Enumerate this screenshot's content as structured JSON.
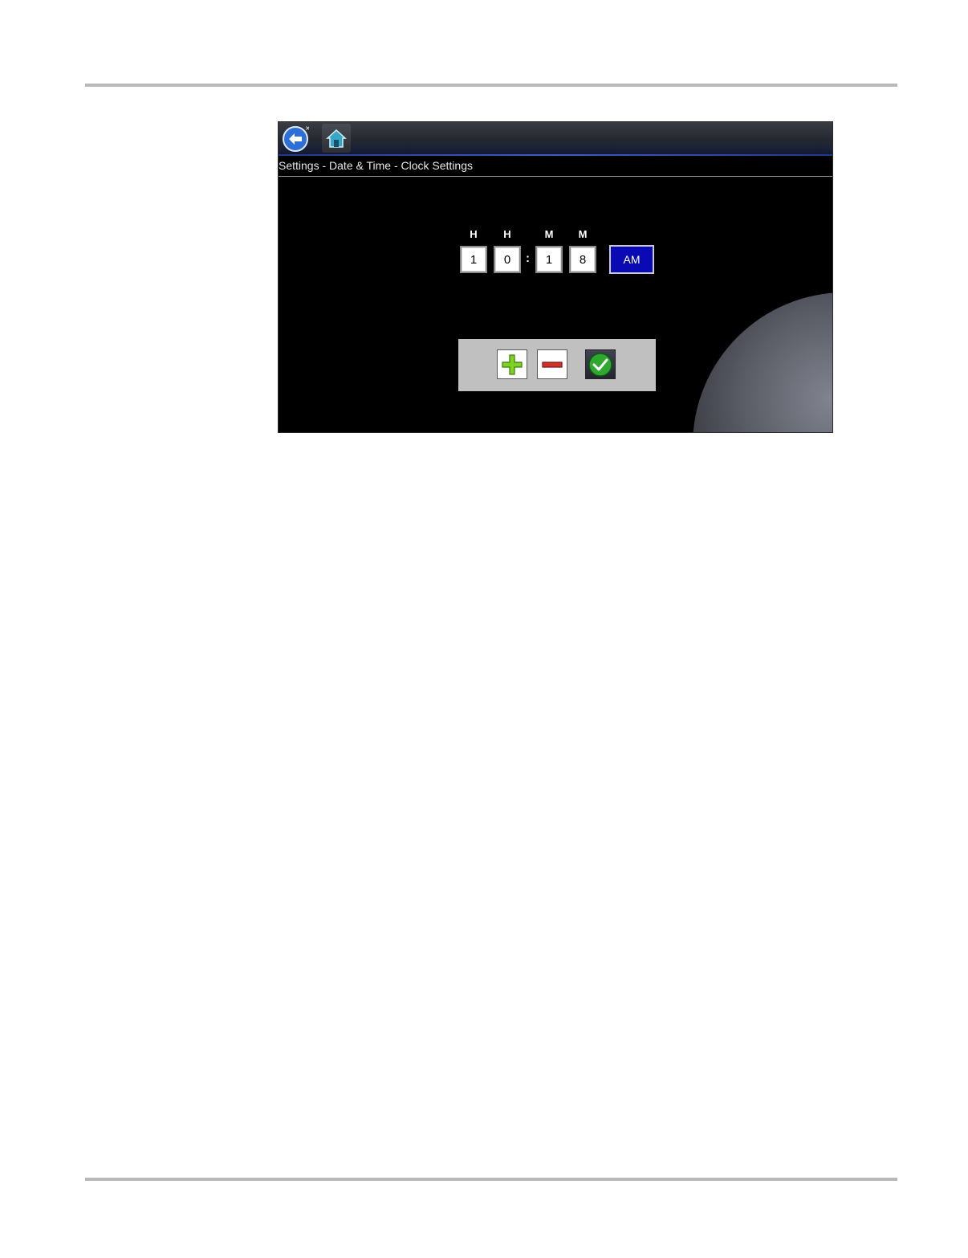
{
  "toolbar": {
    "back_icon": "back-arrow-icon",
    "home_icon": "home-icon"
  },
  "breadcrumb": "Settings - Date & Time - Clock Settings",
  "clock": {
    "headers": [
      "H",
      "H",
      "M",
      "M"
    ],
    "digits": [
      "1",
      "0",
      "1",
      "8"
    ],
    "separator": ":",
    "period": "AM"
  },
  "controls": {
    "increment_icon": "plus-icon",
    "decrement_icon": "minus-icon",
    "confirm_icon": "checkmark-icon"
  },
  "colors": {
    "period_button": "#0a0ab4",
    "confirm_green": "#2fa82f",
    "panel": "#c0c0c0"
  }
}
